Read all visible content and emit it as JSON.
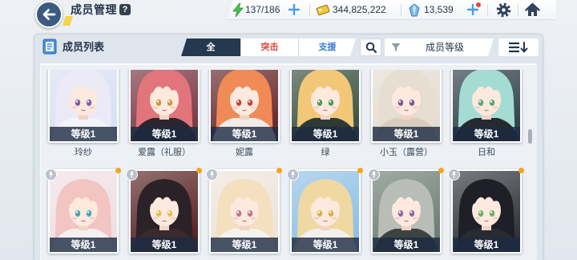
{
  "header": {
    "title": "成员管理",
    "help_label": "?"
  },
  "resources": {
    "ap": {
      "icon": "lightning-icon",
      "value": "137/186"
    },
    "credits": {
      "icon": "credit-card-icon",
      "value": "344,825,222"
    },
    "pyroxene": {
      "icon": "crystal-icon",
      "value": "13,539"
    }
  },
  "panel": {
    "title": "成员列表",
    "tabs": [
      {
        "label": "全",
        "selected": true,
        "color": "#ffffff"
      },
      {
        "label": "突击",
        "selected": false,
        "color": "#e0443c"
      },
      {
        "label": "支援",
        "selected": false,
        "color": "#3b7fd0"
      }
    ],
    "filter": {
      "icon": "funnel-icon",
      "label": "成员等级"
    },
    "sort": {
      "icon": "sort-descending-icon"
    }
  },
  "colors": {
    "accent": "#24384f",
    "tab_selected_bg": "#24384f",
    "level_band": "#1c2a42",
    "alert": "#e5473b"
  },
  "card_badges": {
    "pin_icon": "pin-icon",
    "new_indicator_color": "#f2a51e"
  },
  "students": [
    {
      "name": "玲纱",
      "level": "等级1",
      "portrait": {
        "bg": "#d9e0f2",
        "hair": "#eceaf6",
        "eyes": "#7b5cb3",
        "outfit": "#f4f4f8"
      }
    },
    {
      "name": "爱露（礼服）",
      "level": "等级1",
      "portrait": {
        "bg": "#7c3a46",
        "hair": "#e2747c",
        "eyes": "#c99a3c",
        "outfit": "#2a2630"
      }
    },
    {
      "name": "妮露",
      "level": "等级1",
      "portrait": {
        "bg": "#6a2c30",
        "hair": "#f08a56",
        "eyes": "#c8443a",
        "outfit": "#f2ece8"
      }
    },
    {
      "name": "绿",
      "level": "等级1",
      "portrait": {
        "bg": "#3e5444",
        "hair": "#f2c878",
        "eyes": "#4c9c56",
        "outfit": "#2f3a36"
      }
    },
    {
      "name": "小玉（露营）",
      "level": "等级1",
      "portrait": {
        "bg": "#e4ddd2",
        "hair": "#e6ded0",
        "eyes": "#7a5c96",
        "outfit": "#d8cdbd"
      }
    },
    {
      "name": "日和",
      "level": "等级1",
      "portrait": {
        "bg": "#33444c",
        "hair": "#a4dcd4",
        "eyes": "#5aa87c",
        "outfit": "#262a30"
      }
    },
    {
      "level": "等级1",
      "portrait": {
        "bg": "#eee0e4",
        "hair": "#f2c4c2",
        "eyes": "#4aa2b4",
        "outfit": "#f4f0f2"
      }
    },
    {
      "level": "等级1",
      "portrait": {
        "bg": "#5a2424",
        "hair": "#2b2228",
        "eyes": "#e4c23c",
        "outfit": "#3a2a2e"
      }
    },
    {
      "level": "等级1",
      "portrait": {
        "bg": "#ece4da",
        "hair": "#f4dfbe",
        "eyes": "#c07486",
        "outfit": "#f6f2ee"
      }
    },
    {
      "level": "等级1",
      "portrait": {
        "bg": "#8fc0e6",
        "hair": "#f0d8a2",
        "eyes": "#d8b43c",
        "outfit": "#f2f0ec"
      }
    },
    {
      "level": "等级1",
      "portrait": {
        "bg": "#6e7e74",
        "hair": "#b9bdb8",
        "eyes": "#8c6aa6",
        "outfit": "#3c4440"
      }
    },
    {
      "level": "等级1",
      "portrait": {
        "bg": "#33333e",
        "hair": "#1f1f28",
        "eyes": "#62b466",
        "outfit": "#2a2a34"
      }
    }
  ]
}
